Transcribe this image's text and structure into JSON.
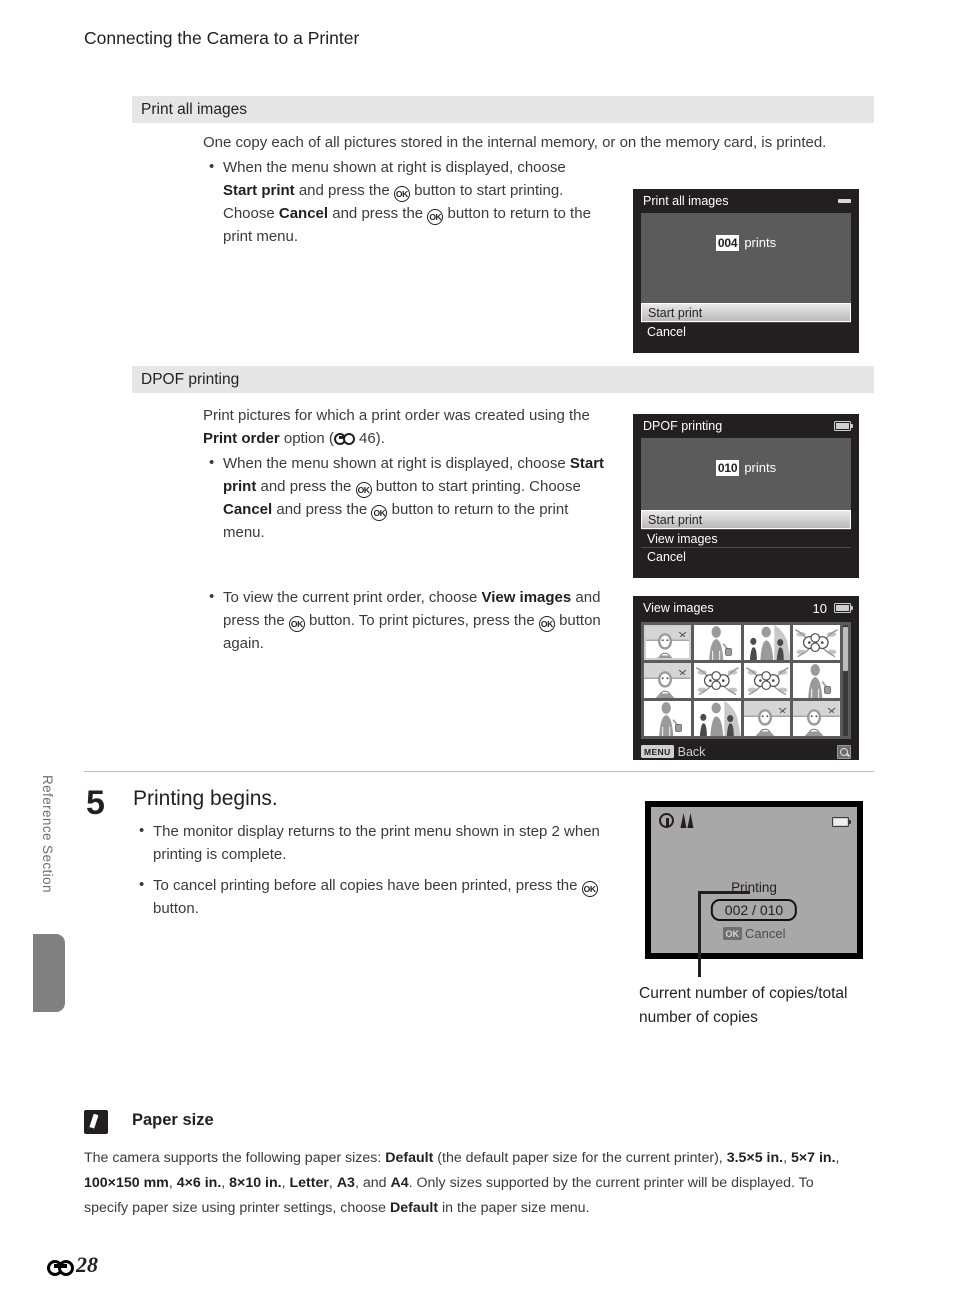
{
  "page": {
    "chapter_title": "Connecting the Camera to a Printer",
    "running_head": "Reference Section",
    "folio_number": "28"
  },
  "sections": [
    {
      "band_label": "Print all images",
      "intro": "One copy each of all pictures stored in the internal memory, or on the memory card, is printed.",
      "bullet_1": "When the menu shown at right is displayed, choose Start print and press the OK button to start printing. Choose Cancel and press the OK button to return to the print menu."
    },
    {
      "band_label": "DPOF printing",
      "intro": "Print pictures for which a print order was created using the Print order option (E 46).",
      "bullet_1": "When the menu shown at right is displayed, choose Start print and press the OK button to start printing. Choose Cancel and press the OK button to return to the print menu.",
      "bullet_2": "To view the current print order, choose View images and press the OK button. To print pictures, press the OK button again."
    }
  ],
  "inline_text": {
    "intro1_a": "One copy each of all pictures stored in the internal memory, or on the memory card, is printed.",
    "b1_p1": "When the menu shown at right is displayed, choose ",
    "b1_start_print": "Start print",
    "b1_p2": " and press the ",
    "b1_p3": " button to start printing. Choose ",
    "b1_cancel": "Cancel",
    "b1_p4": " and press the ",
    "b1_p5": " button to return to the print menu.",
    "dpof_intro_a": "Print pictures for which a print order was created using the ",
    "dpof_print_order": "Print order",
    "dpof_intro_b": " option (",
    "dpof_ref": " 46).",
    "b2_p1": "To view the current print order, choose ",
    "b2_view_images": "View images",
    "b2_p2": " and press the ",
    "b2_p3": " button. To print pictures, press the ",
    "b2_p4": " button again."
  },
  "step5": {
    "number": "5",
    "title": "Printing begins.",
    "bullet_1": "The monitor display returns to the print menu shown in step 2 when printing is complete.",
    "bullet_1a": "The monitor display returns to the print menu shown in step 2 when printing is complete.",
    "bullet_2a": "To cancel printing before all copies have been printed, press the ",
    "bullet_2b": " button."
  },
  "callout": {
    "caption": "Current number of copies/total number of copies"
  },
  "screens": {
    "print_all_images": {
      "title": "Print all images",
      "status_icon": "minus-icon",
      "prints_count": "004",
      "prints_label": "prints",
      "menu": [
        {
          "label": "Start print",
          "selected": true
        },
        {
          "label": "Cancel",
          "selected": false
        }
      ]
    },
    "dpof_printing": {
      "title": "DPOF printing",
      "status_icon": "battery-icon",
      "prints_count": "010",
      "prints_label": "prints",
      "menu": [
        {
          "label": "Start print",
          "selected": true
        },
        {
          "label": "View images",
          "selected": false
        },
        {
          "label": "Cancel",
          "selected": false
        }
      ]
    },
    "view_images": {
      "title": "View images",
      "count": "10",
      "status_icon": "battery-icon",
      "footer_chip": "MENU",
      "footer_label": "Back",
      "footer_icon": "magnifier-icon",
      "thumbnails": [
        {
          "kind": "portrait-landscape",
          "selected": true
        },
        {
          "kind": "woman-bag",
          "selected": false
        },
        {
          "kind": "woman-children",
          "selected": false
        },
        {
          "kind": "flowers",
          "selected": false
        },
        {
          "kind": "portrait-landscape",
          "selected": false
        },
        {
          "kind": "flowers",
          "selected": false
        },
        {
          "kind": "flowers",
          "selected": false
        },
        {
          "kind": "woman-bag",
          "selected": false
        },
        {
          "kind": "woman-bag",
          "selected": false
        },
        {
          "kind": "woman-children",
          "selected": false
        },
        {
          "kind": "portrait-landscape",
          "selected": false
        },
        {
          "kind": "portrait-landscape",
          "selected": false
        }
      ]
    },
    "printing_status": {
      "icon_left_1": "clock-not-set-icon",
      "icon_left_2": "motion-blur-icon",
      "status_icon": "battery-icon",
      "label": "Printing",
      "counter": "002 / 010",
      "cancel_chip": "OK",
      "cancel_label": "Cancel"
    }
  },
  "note": {
    "icon": "pencil-note-icon",
    "title": "Paper size",
    "p1": "The camera supports the following paper sizes: ",
    "default_1": "Default",
    "p2": " (the default paper size for the current printer), ",
    "sizes": [
      "3.5×5 in.",
      "5×7 in.",
      "100×150 mm",
      "4×6 in.",
      "8×10 in.",
      "Letter",
      "A3",
      "A4"
    ],
    "p3": ". Only sizes supported by the current printer will be displayed. To specify paper size using printer settings, choose ",
    "default_2": "Default",
    "p4": " in the paper size menu."
  },
  "colors": {
    "band_bg": "#e6e6e6",
    "lcd_bg": "#231f20",
    "lcd_panel": "#5b5b5b",
    "text": "#231f20",
    "body_text": "#3b3b3b",
    "side_tab": "#808080",
    "printing_bg": "#a8a8a8"
  }
}
